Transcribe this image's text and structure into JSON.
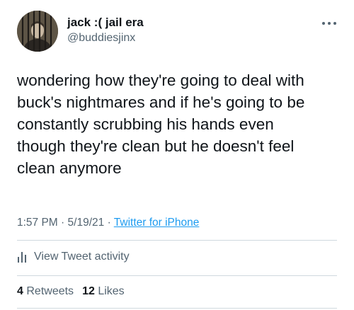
{
  "user": {
    "display_name": "jack :( jail era",
    "handle": "@buddiesjinx",
    "avatar_icon": "profile-photo-behind-bars"
  },
  "tweet": {
    "text": "wondering how they're going to deal with\nbuck's nightmares and if he's going to be\nconstantly scrubbing his hands even\nthough they're clean but he doesn't feel\nclean anymore",
    "time": "1:57 PM",
    "date": "5/19/21",
    "separator": "·",
    "source": "Twitter for iPhone"
  },
  "actions": {
    "more_icon": "more-options-icon",
    "activity_icon": "analytics-bars-icon",
    "activity_label": "View Tweet activity"
  },
  "stats": {
    "retweets_count": "4",
    "retweets_label": "Retweets",
    "likes_count": "12",
    "likes_label": "Likes"
  },
  "colors": {
    "text": "#0f1419",
    "secondary": "#536471",
    "link": "#1d9bf0",
    "divider": "#cfd9de"
  }
}
